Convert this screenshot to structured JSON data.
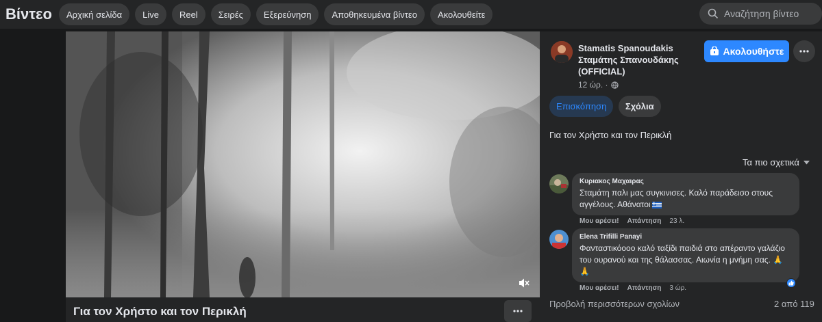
{
  "header": {
    "title": "Βίντεο",
    "tabs": [
      "Αρχική σελίδα",
      "Live",
      "Reel",
      "Σειρές",
      "Εξερεύνηση",
      "Αποθηκευμένα βίντεο",
      "Ακολουθείτε"
    ],
    "search_placeholder": "Αναζήτηση βίντεο"
  },
  "video": {
    "title": "Για τον Χρήστο και τον Περικλή",
    "muted": true
  },
  "post": {
    "author": "Stamatis Spanoudakis Σταμάτης Σπανουδάκης (OFFICIAL)",
    "time": "12 ώρ. ·",
    "follow_label": "Ακολουθήστε",
    "tab_overview": "Επισκόπηση",
    "tab_comments": "Σχόλια",
    "description": "Για τον Χρήστο και τον Περικλή",
    "sort_label": "Τα πιο σχετικά"
  },
  "comments": [
    {
      "name": "Κυριακος Μαχαιρας",
      "text": "Σταμάτη παλι μας συγκινισες. Καλό παράδεισο στους αγγέλους. Αθάνατοι",
      "like_label": "Μου αρέσει!",
      "reply_label": "Απάντηση",
      "time": "23 λ."
    },
    {
      "name": "Elena Trifilli Panayi",
      "text": "Φανταστικόοοο καλό ταξίδι παιδιά στο απέραντο γαλάζιο του ουρανού και της θάλασσας. Αιωνία η μνήμη σας. 🙏🙏",
      "like_label": "Μου αρέσει!",
      "reply_label": "Απάντηση",
      "time": "3 ώρ."
    }
  ],
  "footer": {
    "view_more": "Προβολή περισσότερων σχολίων",
    "count": "2 από 119"
  },
  "colors": {
    "accent": "#2d88ff",
    "background": "#18191a",
    "surface": "#242526",
    "control": "#3a3b3c"
  }
}
